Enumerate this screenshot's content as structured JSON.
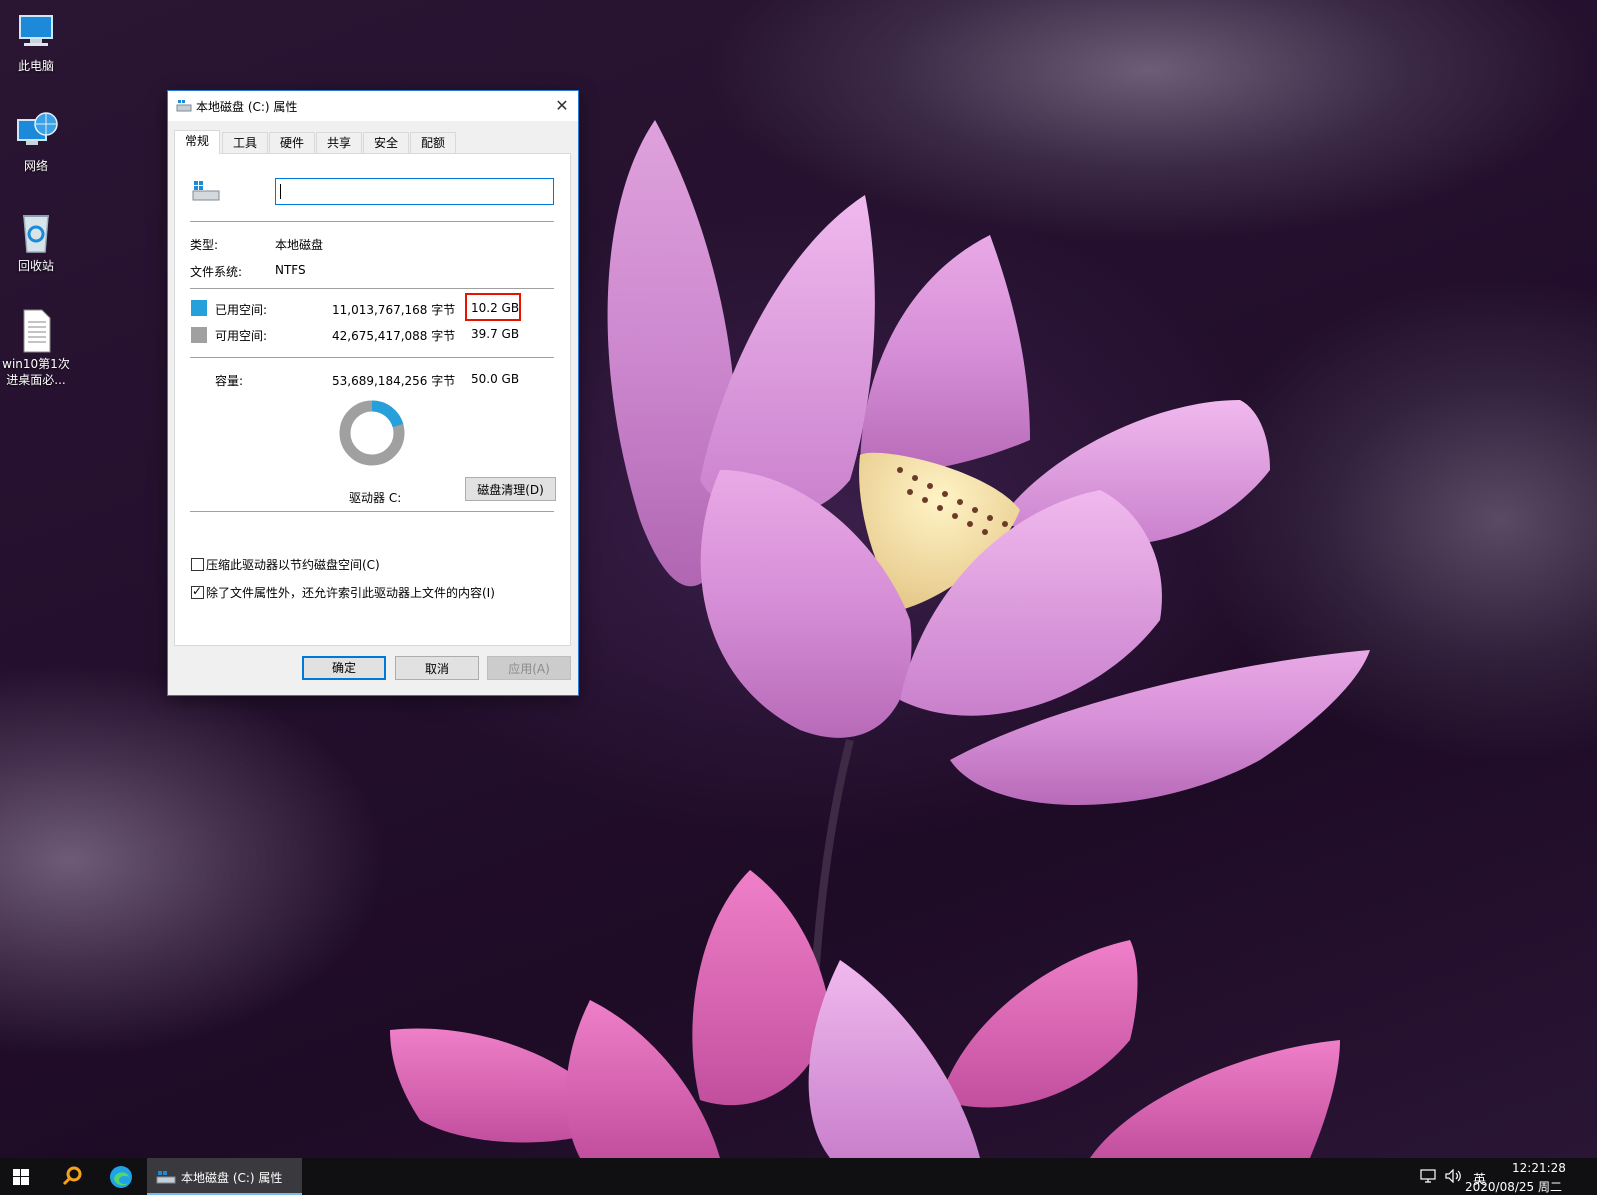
{
  "desktop": {
    "icons": [
      {
        "label": "此电脑",
        "icon": "computer-icon"
      },
      {
        "label": "网络",
        "icon": "network-icon"
      },
      {
        "label": "回收站",
        "icon": "recycle-bin-icon"
      },
      {
        "label": "win10第1次进桌面必...",
        "icon": "text-file-icon"
      }
    ]
  },
  "dialog": {
    "title": "本地磁盘 (C:) 属性",
    "close": "✕",
    "tabs": [
      "常规",
      "工具",
      "硬件",
      "共享",
      "安全",
      "配额"
    ],
    "active_tab": "常规",
    "volume_label_value": "",
    "type_label": "类型:",
    "type_value": "本地磁盘",
    "fs_label": "文件系统:",
    "fs_value": "NTFS",
    "used": {
      "label": "已用空间:",
      "bytes": "11,013,767,168 字节",
      "size": "10.2 GB",
      "color": "#26a0da"
    },
    "free": {
      "label": "可用空间:",
      "bytes": "42,675,417,088 字节",
      "size": "39.7 GB",
      "color": "#a0a0a0"
    },
    "capacity": {
      "label": "容量:",
      "bytes": "53,689,184,256 字节",
      "size": "50.0 GB"
    },
    "usage_fraction": 0.205,
    "drive_label": "驱动器 C:",
    "cleanup_button": "磁盘清理(D)",
    "compress_option": {
      "label": "压缩此驱动器以节约磁盘空间(C)",
      "checked": false
    },
    "index_option": {
      "label": "除了文件属性外，还允许索引此驱动器上文件的内容(I)",
      "checked": true,
      "mark": "✓"
    },
    "ok_button": "确定",
    "cancel_button": "取消",
    "apply_button": "应用(A)"
  },
  "taskbar": {
    "start_icon": "windows-start-icon",
    "search_icon": "search-icon",
    "edge_icon": "edge-browser-icon",
    "active_app": "本地磁盘 (C:) 属性",
    "ime": "英",
    "time": "12:21:28",
    "date": "2020/08/25 周二",
    "accent": "#76b9ed"
  }
}
